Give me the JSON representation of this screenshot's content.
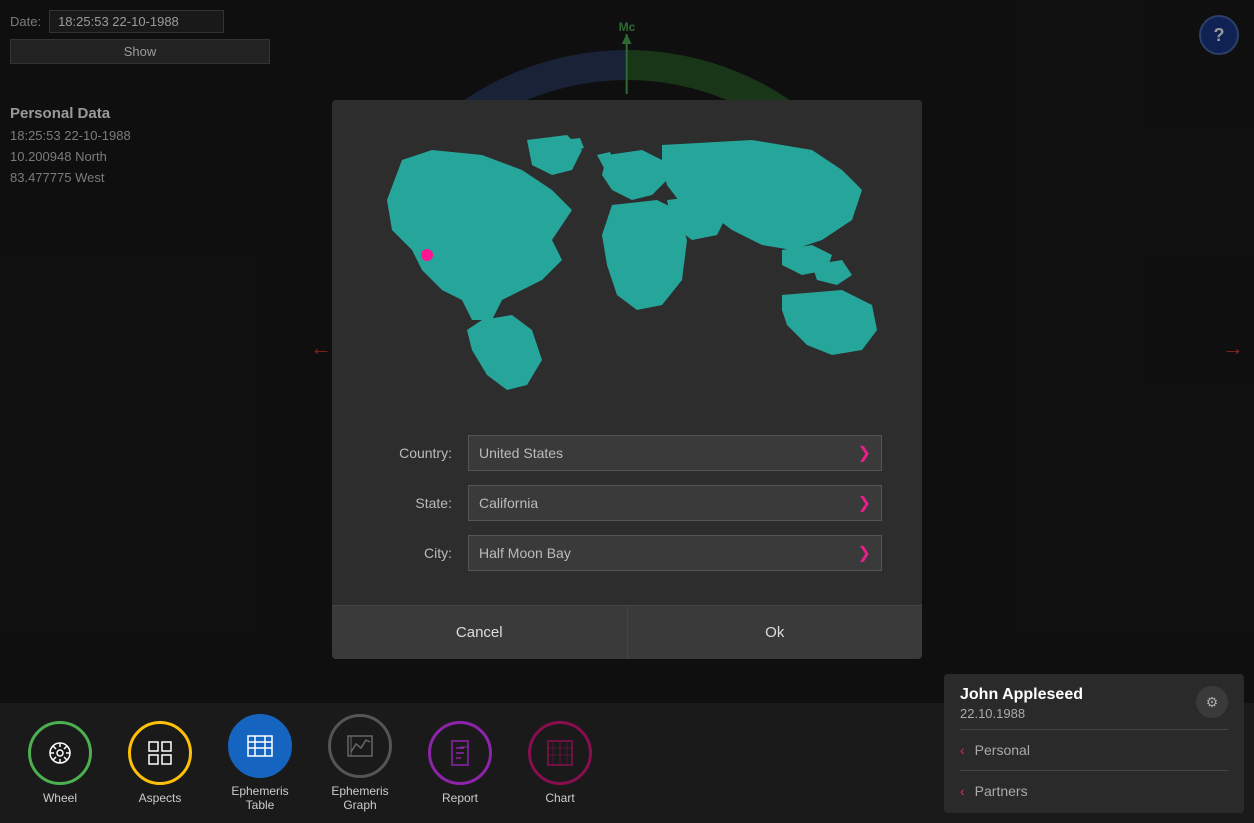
{
  "topbar": {
    "date_label": "Date:",
    "date_value": "18:25:53 22-10-1988",
    "show_label": "Show"
  },
  "personal_data": {
    "title": "Personal Data",
    "datetime": "18:25:53 22-10-1988",
    "latitude": "10.200948 North",
    "longitude": "83.477775 West"
  },
  "help": {
    "label": "?"
  },
  "wheel": {
    "mc_label": "Mc"
  },
  "modal": {
    "country_label": "Country:",
    "country_value": "United States",
    "state_label": "State:",
    "state_value": "California",
    "city_label": "City:",
    "city_value": "Half Moon Bay",
    "cancel_label": "Cancel",
    "ok_label": "Ok"
  },
  "bottom_nav": {
    "items": [
      {
        "id": "wheel",
        "label": "Wheel",
        "icon": "⊙"
      },
      {
        "id": "aspects",
        "label": "Aspects",
        "icon": "⊞"
      },
      {
        "id": "ephemeris-table",
        "label": "Ephemeris\nTable",
        "icon": "⊟"
      },
      {
        "id": "ephemeris-graph",
        "label": "Ephemeris\nGraph",
        "icon": "⋈"
      },
      {
        "id": "report",
        "label": "Report",
        "icon": "❐"
      },
      {
        "id": "chart",
        "label": "Chart",
        "icon": "▣"
      }
    ]
  },
  "profile": {
    "name": "John Appleseed",
    "date": "22.10.1988",
    "personal_label": "Personal",
    "partners_label": "Partners"
  }
}
